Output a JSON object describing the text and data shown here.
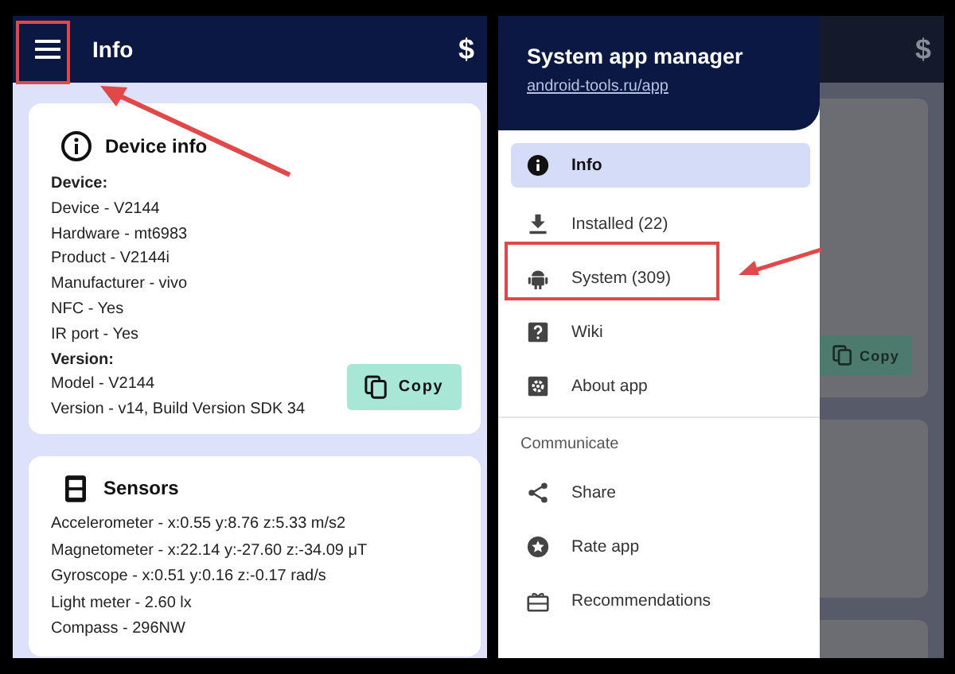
{
  "left_screen": {
    "app_bar": {
      "title": "Info",
      "action": "$"
    },
    "device_card": {
      "title": "Device info",
      "lines": [
        {
          "text": "Device:",
          "kind": "heading"
        },
        {
          "text": "Device - V2144",
          "kind": "value"
        },
        {
          "text": "Hardware - mt6983",
          "kind": "value"
        },
        {
          "text": "Product - V2144i",
          "kind": "value"
        },
        {
          "text": "Manufacturer - vivo",
          "kind": "value"
        },
        {
          "text": "NFC - Yes",
          "kind": "value"
        },
        {
          "text": "IR port - Yes",
          "kind": "value"
        },
        {
          "text": "Version:",
          "kind": "heading"
        },
        {
          "text": "Model - V2144",
          "kind": "value"
        },
        {
          "text": "Version -  v14, Build Version SDK 34",
          "kind": "value"
        }
      ],
      "copy_button": "Copy"
    },
    "sensors_card": {
      "title": "Sensors",
      "lines": [
        "Accelerometer - x:0.55 y:8.76 z:5.33 m/s2",
        "Magnetometer - x:22.14 y:-27.60 z:-34.09 μT",
        "Gyroscope - x:0.51 y:0.16 z:-0.17 rad/s",
        "Light meter - 2.60 lx",
        "Compass - 296NW"
      ]
    }
  },
  "right_screen": {
    "drawer": {
      "title": "System app manager",
      "link": "android-tools.ru/app",
      "items": [
        {
          "label": "Info",
          "selected": true
        },
        {
          "label": "Installed (22)",
          "selected": false
        },
        {
          "label": "System (309)",
          "selected": false
        },
        {
          "label": "Wiki",
          "selected": false
        },
        {
          "label": "About app",
          "selected": false
        }
      ],
      "section": "Communicate",
      "section_items": [
        {
          "label": "Share",
          "selected": false
        },
        {
          "label": "Rate app",
          "selected": false
        },
        {
          "label": "Recommendations",
          "selected": false
        }
      ]
    },
    "background_app": {
      "action": "$",
      "copy_button": "Copy"
    }
  }
}
